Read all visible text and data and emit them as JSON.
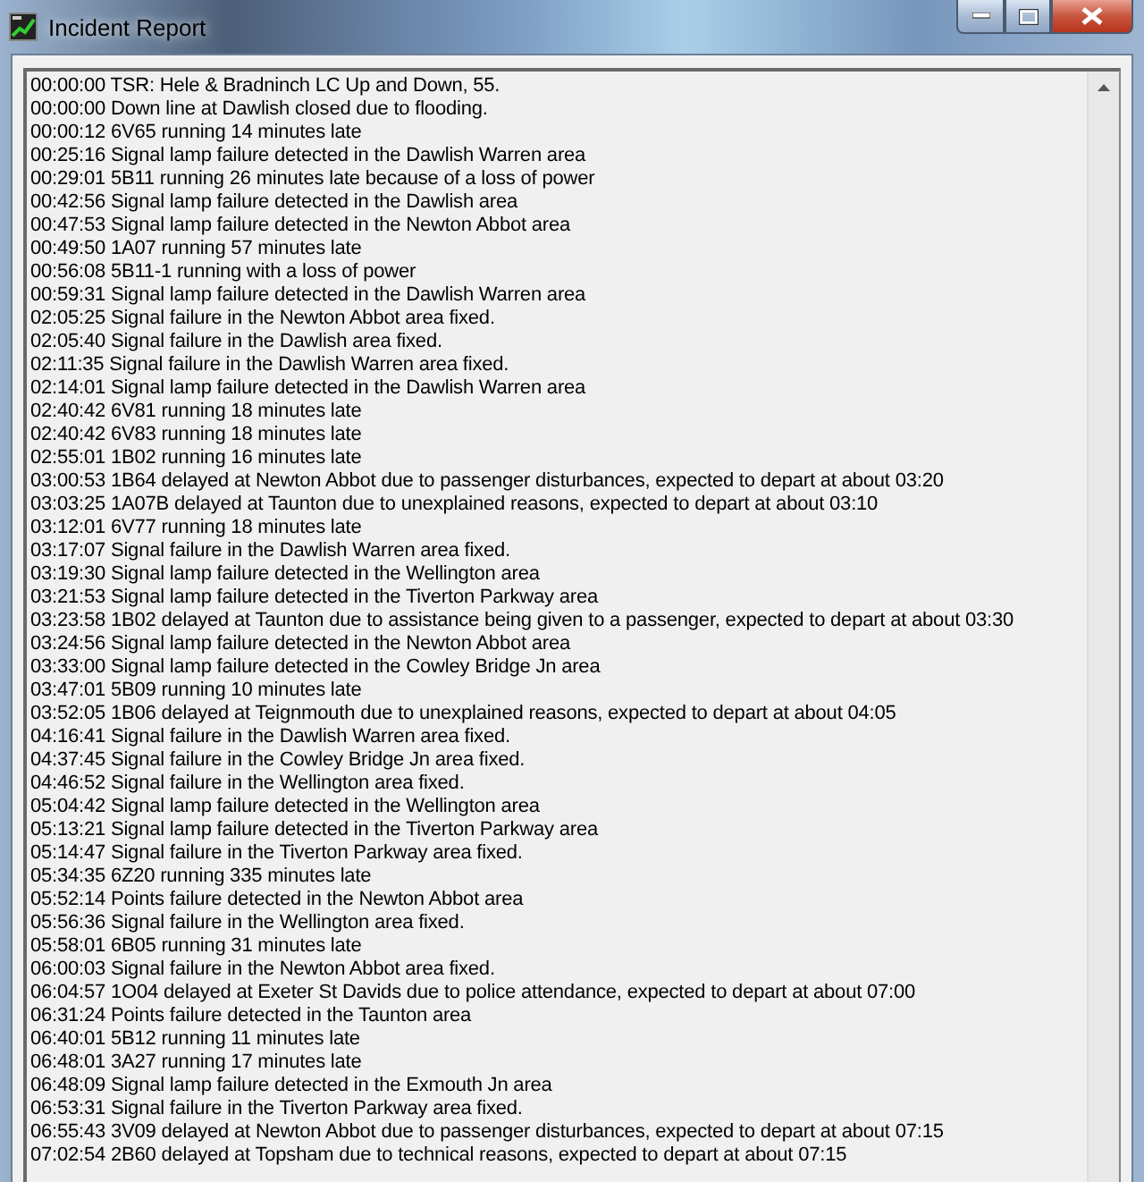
{
  "window": {
    "title": "Incident Report"
  },
  "log": {
    "lines": [
      "00:00:00 TSR: Hele & Bradninch LC Up and Down, 55.",
      "00:00:00 Down line at Dawlish closed due to flooding.",
      "00:00:12 6V65 running 14 minutes late",
      "00:25:16 Signal lamp failure detected in the Dawlish Warren area",
      "00:29:01 5B11 running 26 minutes late because of a loss of power",
      "00:42:56 Signal lamp failure detected in the Dawlish area",
      "00:47:53 Signal lamp failure detected in the Newton Abbot area",
      "00:49:50 1A07 running 57 minutes late",
      "00:56:08 5B11-1 running with a loss of power",
      "00:59:31 Signal lamp failure detected in the Dawlish Warren area",
      "02:05:25 Signal failure in the Newton Abbot area fixed.",
      "02:05:40 Signal failure in the Dawlish area fixed.",
      "02:11:35 Signal failure in the Dawlish Warren area fixed.",
      "02:14:01 Signal lamp failure detected in the Dawlish Warren area",
      "02:40:42 6V81 running 18 minutes late",
      "02:40:42 6V83 running 18 minutes late",
      "02:55:01 1B02 running 16 minutes late",
      "03:00:53 1B64 delayed at Newton Abbot due to passenger disturbances, expected to depart at about 03:20",
      "03:03:25 1A07B delayed at Taunton due to unexplained reasons, expected to depart at about 03:10",
      "03:12:01 6V77 running 18 minutes late",
      "03:17:07 Signal failure in the Dawlish Warren area fixed.",
      "03:19:30 Signal lamp failure detected in the Wellington area",
      "03:21:53 Signal lamp failure detected in the Tiverton Parkway area",
      "03:23:58 1B02 delayed at Taunton due to assistance being given to a passenger, expected to depart at about 03:30",
      "03:24:56 Signal lamp failure detected in the Newton Abbot area",
      "03:33:00 Signal lamp failure detected in the Cowley Bridge Jn area",
      "03:47:01 5B09 running 10 minutes late",
      "03:52:05 1B06 delayed at Teignmouth due to unexplained reasons, expected to depart at about 04:05",
      "04:16:41 Signal failure in the Dawlish Warren area fixed.",
      "04:37:45 Signal failure in the Cowley Bridge Jn area fixed.",
      "04:46:52 Signal failure in the Wellington area fixed.",
      "05:04:42 Signal lamp failure detected in the Wellington area",
      "05:13:21 Signal lamp failure detected in the Tiverton Parkway area",
      "05:14:47 Signal failure in the Tiverton Parkway area fixed.",
      "05:34:35 6Z20 running 335 minutes late",
      "05:52:14 Points failure detected in the Newton Abbot area",
      "05:56:36 Signal failure in the Wellington area fixed.",
      "05:58:01 6B05 running 31 minutes late",
      "06:00:03 Signal failure in the Newton Abbot area fixed.",
      "06:04:57 1O04 delayed at Exeter St Davids due to police attendance, expected to depart at about 07:00",
      "06:31:24 Points failure detected in the Taunton area",
      "06:40:01 5B12 running 11 minutes late",
      "06:48:01 3A27 running 17 minutes late",
      "06:48:09 Signal lamp failure detected in the Exmouth Jn area",
      "06:53:31 Signal failure in the Tiverton Parkway area fixed.",
      "06:55:43 3V09 delayed at Newton Abbot due to passenger disturbances, expected to depart at about 07:15",
      "07:02:54 2B60 delayed at Topsham due to technical reasons, expected to depart at about 07:15"
    ]
  }
}
